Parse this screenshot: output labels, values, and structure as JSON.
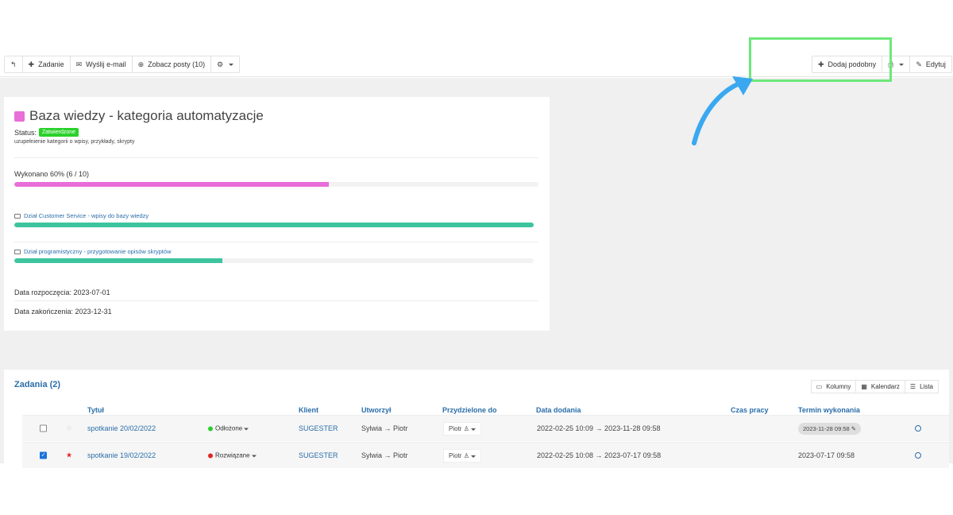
{
  "toolbar": {
    "back_icon": "back-arrow-icon",
    "task_label": "Zadanie",
    "email_label": "Wyślij e-mail",
    "posts_label": "Zobacz posty (10)",
    "add_similar_label": "Dodaj podobny",
    "edit_label": "Edytuj"
  },
  "project": {
    "title": "Baza wiedzy - kategoria automatyzacje",
    "color": "#e86ed8",
    "status_label": "Status:",
    "status_value": "Zatwierdzone",
    "description": "uzupełnienie kategorii o wpisy, przykłady, skrypty",
    "progress_label": "Wykonano 60% (6 / 10)",
    "progress_fraction": 0.6,
    "subprojects": [
      {
        "name": "Dział Customer Service - wpisy do bazy wiedzy",
        "progress_fraction": 1.0
      },
      {
        "name": "Dział programistyczny - przygotowanie opisów skryptów",
        "progress_fraction": 0.4
      }
    ],
    "start_date": "Data rozpoczęcia: 2023-07-01",
    "end_date": "Data zakończenia: 2023-12-31"
  },
  "tasks": {
    "title": "Zadania (2)",
    "views": [
      "Kolumny",
      "Kalendarz",
      "Lista"
    ],
    "headers": [
      "Tytuł",
      "Klient",
      "Utworzył",
      "Przydzielone do",
      "Data dodania",
      "Czas pracy",
      "Termin wykonania"
    ],
    "rows": [
      {
        "checked": false,
        "starred": false,
        "title": "spotkanie 20/02/2022",
        "state": "Odłożone",
        "state_color": "#2bd12b",
        "client": "SUGESTER",
        "created_by": "Sylwia → Piotr",
        "assigned": "Piotr",
        "added": "2022-02-25 10:09 → 2023-11-28 09:58",
        "deadline": "2023-11-28 09:58"
      },
      {
        "checked": true,
        "starred": true,
        "title": "spotkanie 19/02/2022",
        "state": "Rozwiązane",
        "state_color": "#e02424",
        "client": "SUGESTER",
        "created_by": "Sylwia → Piotr",
        "assigned": "Piotr",
        "added": "2022-02-25 10:08 → 2023-07-17 09:58",
        "deadline": "2023-07-17 09:58"
      }
    ]
  },
  "colors": {
    "accent": "#2a6eaa",
    "progress_main": "#e86ed8",
    "progress_sub": "#3ec49e",
    "highlight": "#6de87a",
    "arrow": "#3aa8f0"
  }
}
